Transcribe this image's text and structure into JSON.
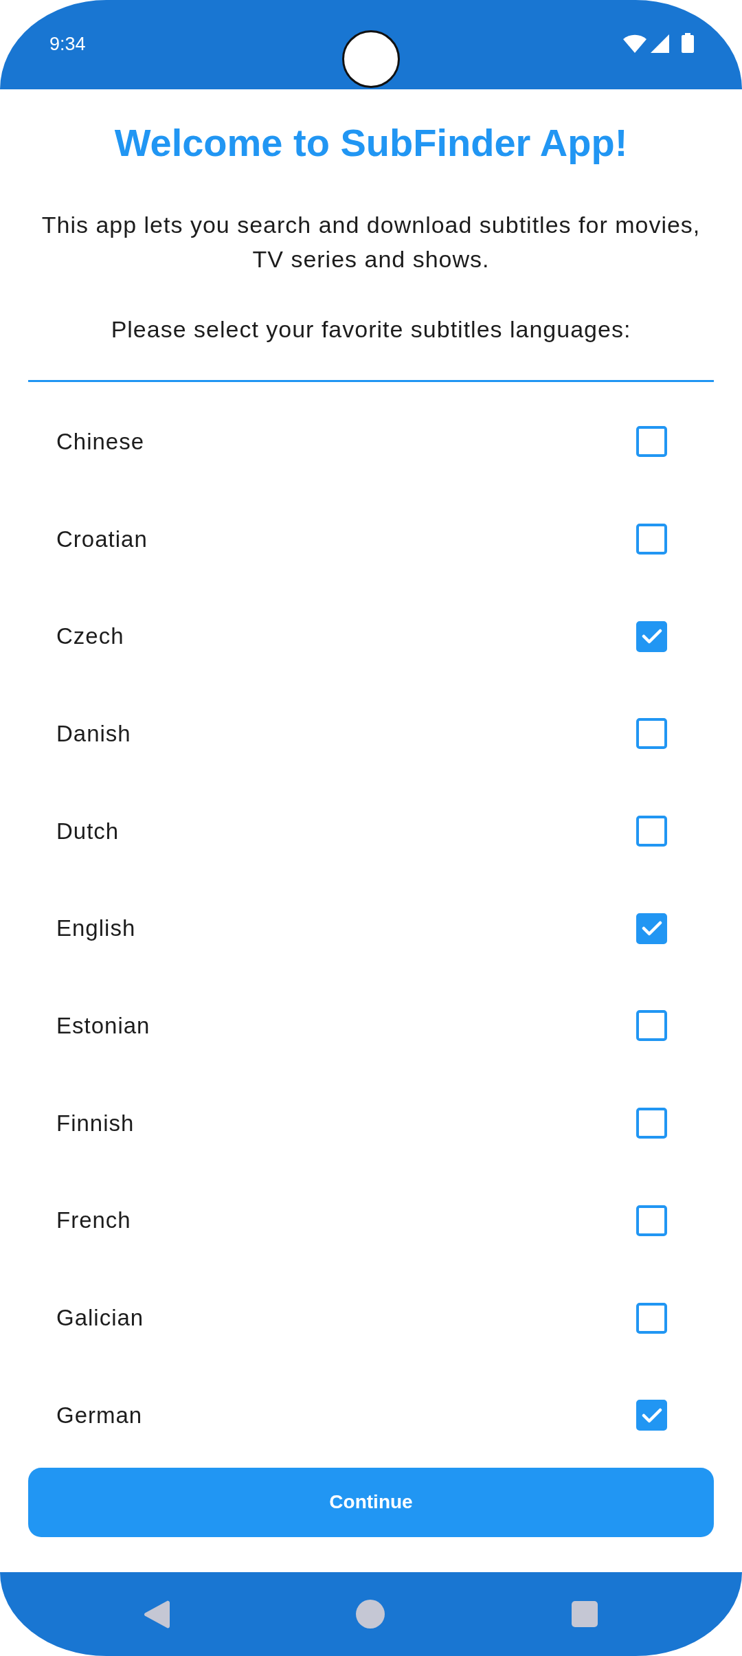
{
  "status_bar": {
    "time": "9:34"
  },
  "header": {
    "title": "Welcome to SubFinder App!",
    "description": "This app lets you search and download subtitles for movies, TV series and shows.",
    "prompt": "Please select your favorite subtitles languages:"
  },
  "languages": [
    {
      "name": "Chinese",
      "checked": false
    },
    {
      "name": "Croatian",
      "checked": false
    },
    {
      "name": "Czech",
      "checked": true
    },
    {
      "name": "Danish",
      "checked": false
    },
    {
      "name": "Dutch",
      "checked": false
    },
    {
      "name": "English",
      "checked": true
    },
    {
      "name": "Estonian",
      "checked": false
    },
    {
      "name": "Finnish",
      "checked": false
    },
    {
      "name": "French",
      "checked": false
    },
    {
      "name": "Galician",
      "checked": false
    },
    {
      "name": "German",
      "checked": true
    }
  ],
  "continue_button": {
    "label": "Continue"
  }
}
